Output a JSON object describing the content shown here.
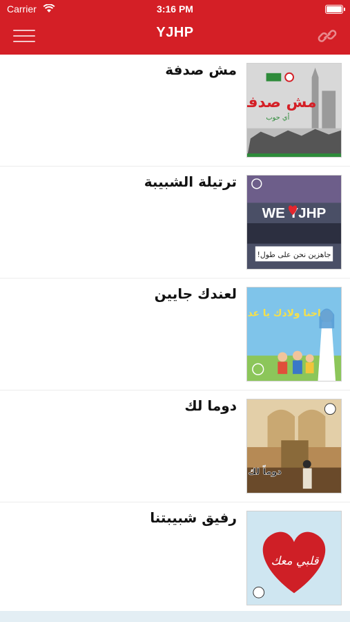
{
  "status_bar": {
    "carrier": "Carrier",
    "time": "3:16 PM"
  },
  "header": {
    "title": "YJHP",
    "menu_icon": "hamburger-menu-icon",
    "link_icon": "chain-link-icon"
  },
  "colors": {
    "header_bg": "#d41f26",
    "accent": "#d41f26"
  },
  "items": [
    {
      "title": "مش صدفة",
      "thumb_text": "مش صدفة",
      "thumb_subtext": "أي حوب"
    },
    {
      "title": "ترتيلة الشبيبة",
      "thumb_text": "WE YJHP",
      "thumb_subtext": "جاهزين نحن على طول!"
    },
    {
      "title": "لعندك جايين",
      "thumb_text": "احنا ولادك يا عدرا"
    },
    {
      "title": "دوما لك",
      "thumb_text": "دوماً لك"
    },
    {
      "title": "رفيق شبيبتنا",
      "thumb_text": "قلبي معك"
    }
  ]
}
